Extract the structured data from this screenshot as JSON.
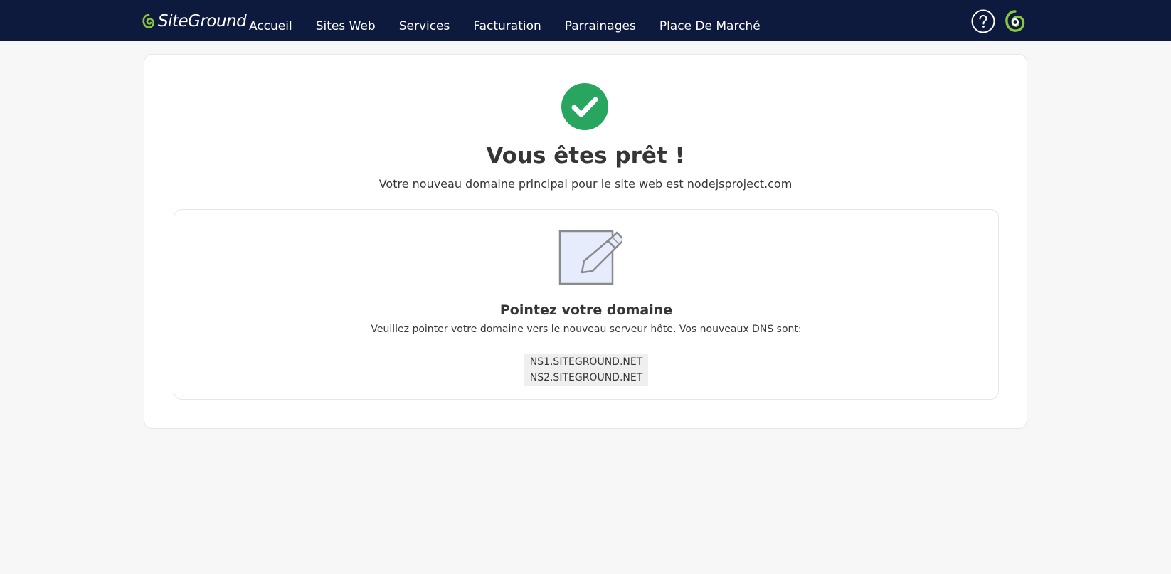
{
  "header": {
    "logo_text": "SiteGround",
    "nav": [
      "Accueil",
      "Sites Web",
      "Services",
      "Facturation",
      "Parrainages",
      "Place De Marché"
    ],
    "help_icon": "question-circle-icon",
    "account_icon": "siteground-account-icon"
  },
  "main": {
    "success_icon": "check-circle-icon",
    "title": "Vous êtes prêt !",
    "subtitle": "Votre nouveau domaine principal pour le site web est nodejsproject.com",
    "dns_card": {
      "illustration": "edit-document-icon",
      "title": "Pointez votre domaine",
      "description": "Veuillez pointer votre domaine vers le nouveau serveur hôte. Vos nouveaux DNS sont:",
      "nameservers": [
        "NS1.SITEGROUND.NET",
        "NS2.SITEGROUND.NET"
      ]
    }
  },
  "colors": {
    "header_bg": "#0d1a3d",
    "brand_green": "#8cc63f",
    "success_green": "#28a55f",
    "page_bg": "#f7f7f7"
  }
}
